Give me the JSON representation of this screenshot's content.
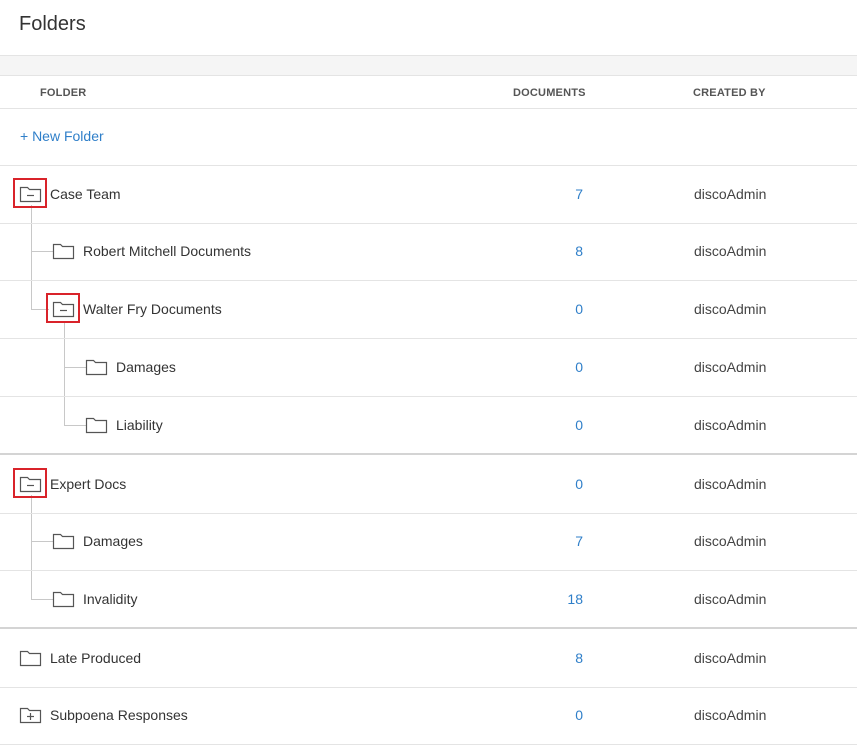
{
  "page": {
    "title": "Folders"
  },
  "table": {
    "headers": {
      "folder": "FOLDER",
      "documents": "DOCUMENTS",
      "created_by": "CREATED BY"
    },
    "new_folder_label": "+ New Folder",
    "rows": [
      {
        "name": "Case Team",
        "documents": "7",
        "created_by": "discoAdmin",
        "icon": "folder-collapse-icon",
        "highlighted": true
      },
      {
        "name": "Robert Mitchell Documents",
        "documents": "8",
        "created_by": "discoAdmin",
        "icon": "folder-icon"
      },
      {
        "name": "Walter Fry Documents",
        "documents": "0",
        "created_by": "discoAdmin",
        "icon": "folder-collapse-icon",
        "highlighted": true
      },
      {
        "name": "Damages",
        "documents": "0",
        "created_by": "discoAdmin",
        "icon": "folder-icon"
      },
      {
        "name": "Liability",
        "documents": "0",
        "created_by": "discoAdmin",
        "icon": "folder-icon"
      },
      {
        "name": "Expert Docs",
        "documents": "0",
        "created_by": "discoAdmin",
        "icon": "folder-collapse-icon",
        "highlighted": true
      },
      {
        "name": "Damages",
        "documents": "7",
        "created_by": "discoAdmin",
        "icon": "folder-icon"
      },
      {
        "name": "Invalidity",
        "documents": "18",
        "created_by": "discoAdmin",
        "icon": "folder-icon"
      },
      {
        "name": "Late Produced",
        "documents": "8",
        "created_by": "discoAdmin",
        "icon": "folder-icon"
      },
      {
        "name": "Subpoena Responses",
        "documents": "0",
        "created_by": "discoAdmin",
        "icon": "folder-expand-icon"
      }
    ]
  },
  "colors": {
    "link": "#2f7fc9",
    "highlight": "#d9232a",
    "divider": "#e4e4e4",
    "tree_line": "#c8c8c8"
  }
}
